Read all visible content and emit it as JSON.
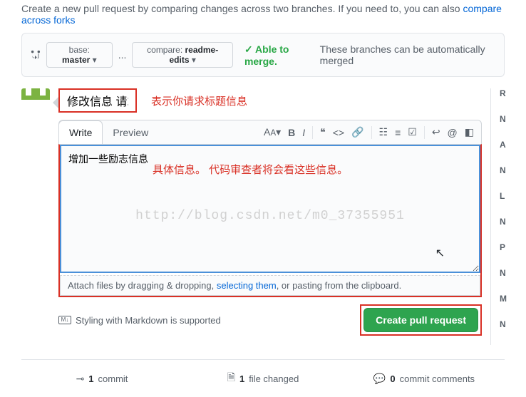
{
  "topText": {
    "prefix": "Create a new pull request by comparing changes across two branches. If you need to, you can also ",
    "link": "compare across forks"
  },
  "branchBar": {
    "baseLabel": "base:",
    "baseBranch": "master",
    "compareLabel": "compare:",
    "compareBranch": "readme-edits",
    "mergeStatus": "Able to merge.",
    "mergeDesc": "These branches can be automatically merged"
  },
  "title": {
    "value": "修改信息 请求",
    "annotation": "表示你请求标题信息"
  },
  "tabs": {
    "write": "Write",
    "preview": "Preview"
  },
  "body": {
    "value": "增加一些励志信息",
    "annotation": "具体信息。 代码审查者将会看这些信息。",
    "watermark": "http://blog.csdn.net/m0_37355951"
  },
  "attachBar": {
    "pre": "Attach files by dragging & dropping, ",
    "link": "selecting them",
    "post": ", or pasting from the clipboard."
  },
  "markdown": {
    "text": "Styling with Markdown is supported"
  },
  "createButton": "Create pull request",
  "sidebar": [
    "R",
    "N",
    "A",
    "N",
    "L",
    "N",
    "P",
    "N",
    "M",
    "N"
  ],
  "stats": {
    "commits": {
      "count": "1",
      "label": "commit"
    },
    "files": {
      "count": "1",
      "label": "file changed"
    },
    "comments": {
      "count": "0",
      "label": "commit comments"
    }
  }
}
